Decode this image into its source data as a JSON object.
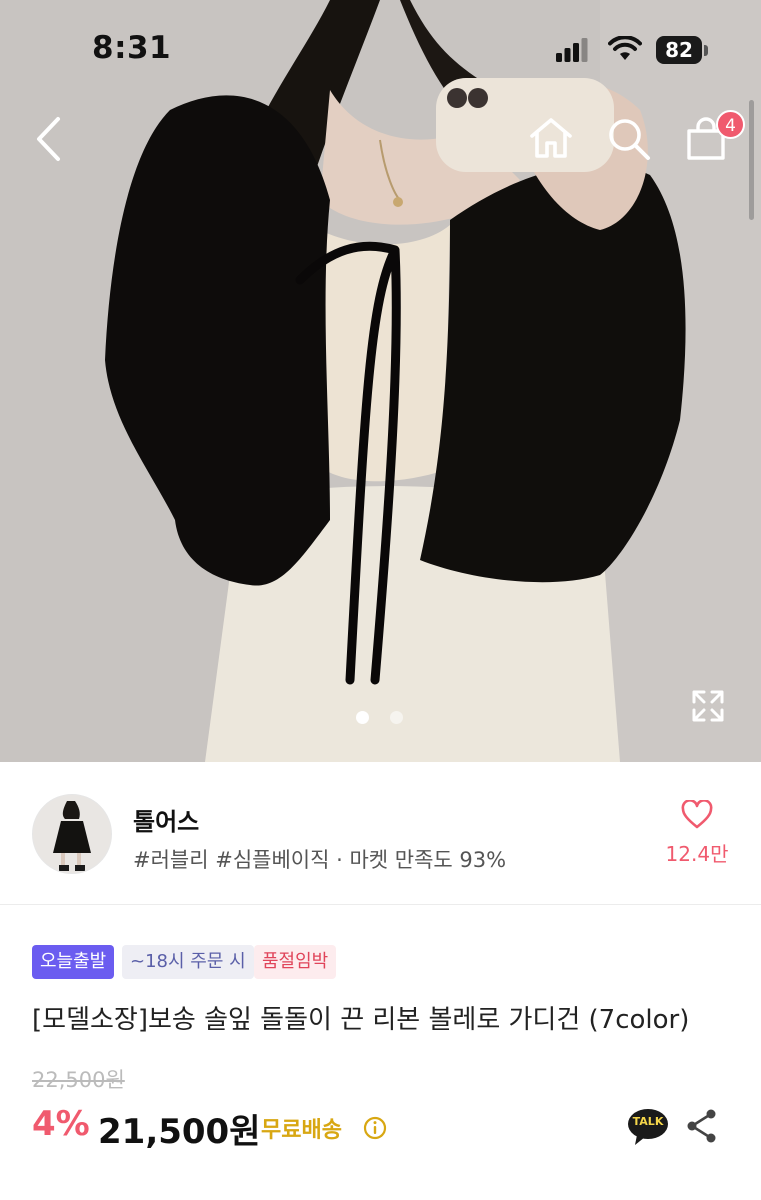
{
  "status_bar": {
    "time": "8:31",
    "battery": "82"
  },
  "nav": {
    "back_icon": "chevron-left-icon",
    "home_icon": "home-icon",
    "search_icon": "search-icon",
    "cart_icon": "shopping-bag-icon",
    "cart_count": "4"
  },
  "gallery": {
    "image_count": 2,
    "active_index": 0,
    "expand_icon": "expand-icon"
  },
  "seller": {
    "name": "톨어스",
    "tags": "#러블리 #심플베이직 · 마켓 만족도 93%",
    "like_icon": "heart-icon",
    "like_count": "12.4만"
  },
  "product": {
    "badges": [
      {
        "label": "오늘출발"
      },
      {
        "label": "~18시 주문 시"
      },
      {
        "label": "품절임박"
      }
    ],
    "title": "[모델소장]보송 솔잎 돌돌이 끈 리본 볼레로 가디건 (7color)",
    "original_price": "22,500원",
    "discount": "4%",
    "price": "21,500원",
    "free_shipping": "무료배송",
    "talk_label": "TALK",
    "share_icon": "share-icon"
  },
  "colors": {
    "accent_pink": "#f05a6e",
    "badge_purple": "#6b5cf0",
    "free_ship_gold": "#d8a712"
  }
}
